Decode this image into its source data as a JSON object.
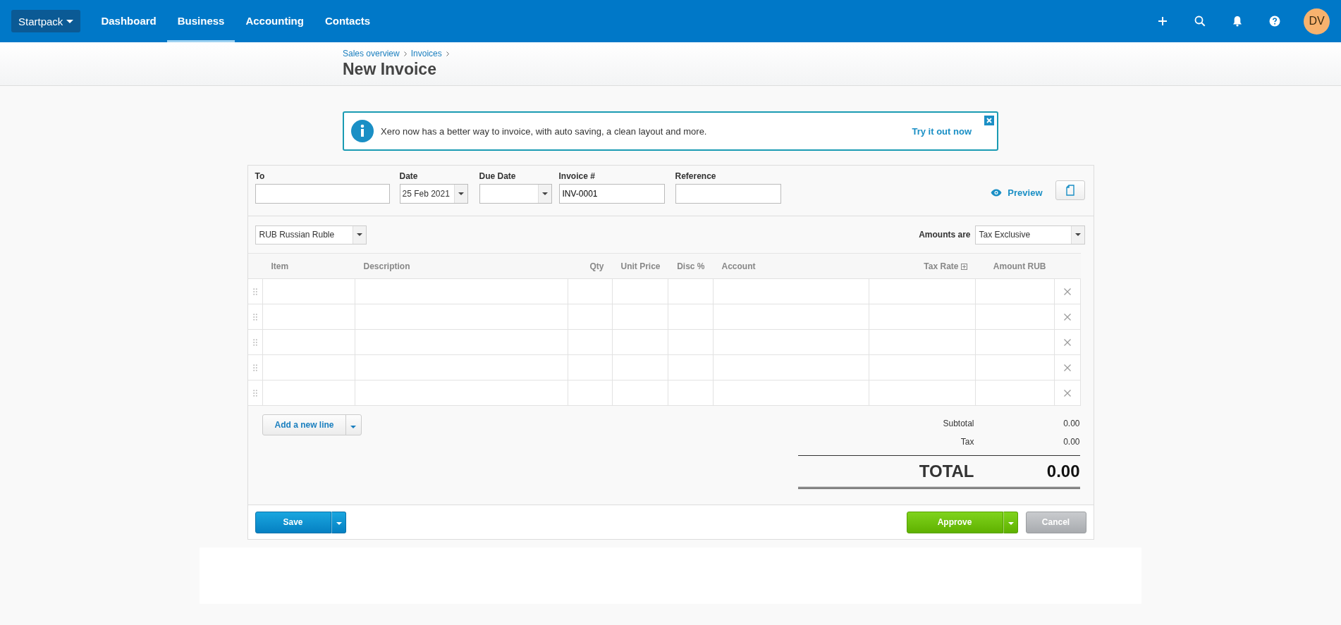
{
  "top_nav": {
    "org_menu": "Startpack",
    "items": [
      {
        "label": "Dashboard",
        "selected": false
      },
      {
        "label": "Business",
        "selected": true
      },
      {
        "label": "Accounting",
        "selected": false
      },
      {
        "label": "Contacts",
        "selected": false
      }
    ],
    "avatar": "DV"
  },
  "breadcrumb": [
    "Sales overview",
    "Invoices"
  ],
  "page_title": "New Invoice",
  "banner": {
    "message": "Xero now has a better way to invoice, with auto saving, a clean layout and more.",
    "link": "Try it out now"
  },
  "fields": {
    "to": {
      "label": "To"
    },
    "date": {
      "label": "Date",
      "value": "25 Feb 2021"
    },
    "due_date": {
      "label": "Due Date"
    },
    "invoice_number": {
      "label": "Invoice #",
      "value": "INV-0001"
    },
    "reference": {
      "label": "Reference"
    }
  },
  "preview": "Preview",
  "currency": "RUB Russian Ruble",
  "amounts_are": {
    "label": "Amounts are",
    "value": "Tax Exclusive"
  },
  "table": {
    "columns": [
      {
        "label": "Item"
      },
      {
        "label": "Description"
      },
      {
        "label": "Qty"
      },
      {
        "label": "Unit Price"
      },
      {
        "label": "Disc %"
      },
      {
        "label": "Account"
      },
      {
        "label": "Tax Rate"
      },
      {
        "label": "Amount RUB"
      }
    ],
    "row_count_rows": [
      {},
      {},
      {},
      {},
      {}
    ]
  },
  "add_line": "Add a new line",
  "totals": {
    "subtotal": {
      "label": "Subtotal",
      "value": "0.00"
    },
    "tax": {
      "label": "Tax",
      "value": "0.00"
    },
    "total": {
      "label": "TOTAL",
      "value": "0.00"
    }
  },
  "buttons": {
    "save": "Save",
    "approve": "Approve",
    "cancel": "Cancel"
  }
}
